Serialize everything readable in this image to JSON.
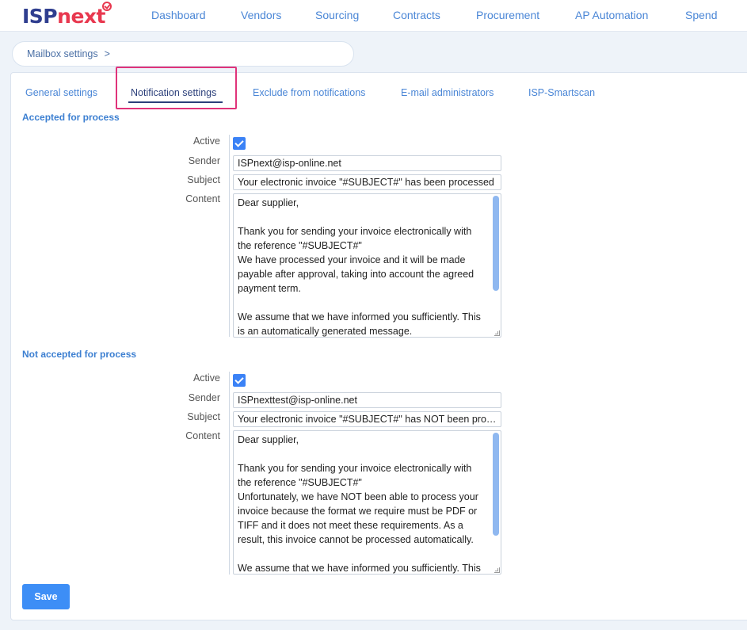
{
  "logo": {
    "part1": "ISP",
    "part2": "next"
  },
  "nav": [
    "Dashboard",
    "Vendors",
    "Sourcing",
    "Contracts",
    "Procurement",
    "AP Automation",
    "Spend"
  ],
  "breadcrumb": {
    "label": "Mailbox settings",
    "separator": ">"
  },
  "tabs": [
    "General settings",
    "Notification settings",
    "Exclude from notifications",
    "E-mail administrators",
    "ISP-Smartscan"
  ],
  "active_tab": "Notification settings",
  "labels": {
    "active": "Active",
    "sender": "Sender",
    "subject": "Subject",
    "content": "Content"
  },
  "accepted": {
    "title": "Accepted for process",
    "active": true,
    "sender": "ISPnext@isp-online.net",
    "subject": "Your electronic invoice \"#SUBJECT#\" has been processed",
    "content_lines": [
      "Dear supplier,",
      "",
      "Thank you for sending your invoice electronically with the reference \"#SUBJECT#\"",
      "We have processed your invoice and it will be made payable after approval, taking into account the agreed payment term.",
      "",
      "We assume that we have informed you sufficiently. This is an automatically generated message."
    ]
  },
  "not_accepted": {
    "title": "Not accepted for process",
    "active": true,
    "sender": "ISPnexttest@isp-online.net",
    "subject": " Your electronic invoice \"#SUBJECT#\" has NOT been processed",
    "content_lines": [
      "Dear supplier,",
      "",
      "Thank you for sending your invoice electronically with the reference \"#SUBJECT#\"",
      "Unfortunately, we have NOT been able to process your invoice because the format we require must be PDF or TIFF and it does not meet these requirements. As a result, this invoice cannot be processed automatically.",
      "",
      "We assume that we have informed you sufficiently. This"
    ]
  },
  "save_label": "Save",
  "colors": {
    "accent": "#3d8ef6",
    "highlight": "#e0337a",
    "brand_dark": "#2f3e8f",
    "brand_red": "#e8384f"
  }
}
